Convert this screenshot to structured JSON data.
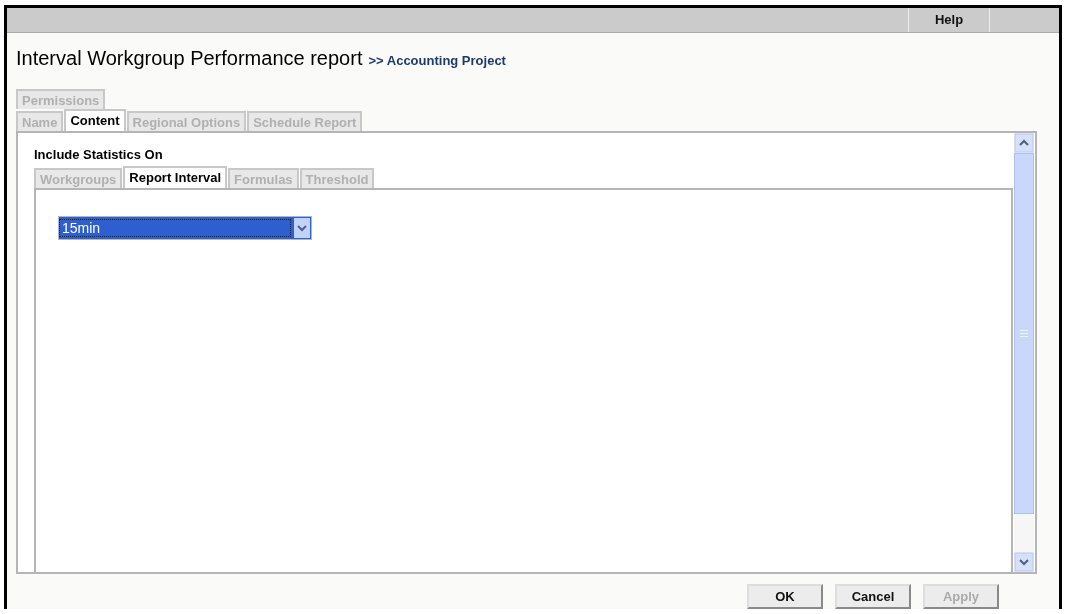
{
  "menu_bar": {
    "items": [
      "Help"
    ]
  },
  "title": "Interval Workgroup Performance report",
  "breadcrumb": ">> Accounting Project",
  "tab_rows": [
    [
      {
        "label": "Permissions",
        "selected": false
      }
    ],
    [
      {
        "label": "Name",
        "selected": false
      },
      {
        "label": "Content",
        "selected": true
      },
      {
        "label": "Regional Options",
        "selected": false
      },
      {
        "label": "Schedule Report",
        "selected": false
      }
    ]
  ],
  "section_title": "Include Statistics On",
  "inner_tabs": [
    {
      "label": "Workgroups",
      "selected": false
    },
    {
      "label": "Report Interval",
      "selected": true
    },
    {
      "label": "Formulas",
      "selected": false
    },
    {
      "label": "Threshold",
      "selected": false
    }
  ],
  "interval_select": {
    "value": "15min"
  },
  "buttons": [
    {
      "label": "OK",
      "disabled": false
    },
    {
      "label": "Cancel",
      "disabled": false
    },
    {
      "label": "Apply",
      "disabled": true
    }
  ]
}
